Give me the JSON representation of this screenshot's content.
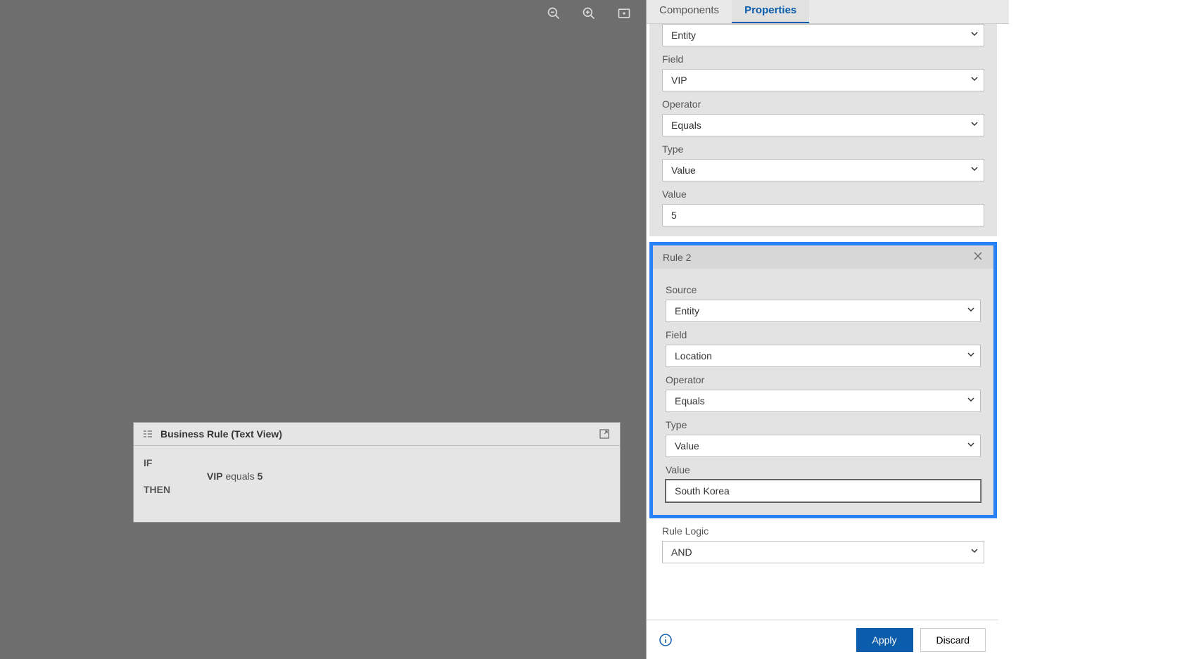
{
  "tabs": {
    "components": "Components",
    "properties": "Properties"
  },
  "rule1": {
    "source_value": "Entity",
    "field_label": "Field",
    "field_value": "VIP",
    "operator_label": "Operator",
    "operator_value": "Equals",
    "type_label": "Type",
    "type_value": "Value",
    "value_label": "Value",
    "value_value": "5"
  },
  "rule2": {
    "title": "Rule 2",
    "source_label": "Source",
    "source_value": "Entity",
    "field_label": "Field",
    "field_value": "Location",
    "operator_label": "Operator",
    "operator_value": "Equals",
    "type_label": "Type",
    "type_value": "Value",
    "value_label": "Value",
    "value_value": "South Korea"
  },
  "ruleLogic": {
    "label": "Rule Logic",
    "value": "AND"
  },
  "actions": {
    "apply": "Apply",
    "discard": "Discard"
  },
  "textView": {
    "title": "Business Rule (Text View)",
    "if_keyword": "IF",
    "then_keyword": "THEN",
    "rule_field": "VIP",
    "rule_operator": "equals",
    "rule_value": "5"
  },
  "icons": {
    "zoom_out": "zoom-out-icon",
    "zoom_in": "zoom-in-icon",
    "fit": "fit-screen-icon"
  }
}
